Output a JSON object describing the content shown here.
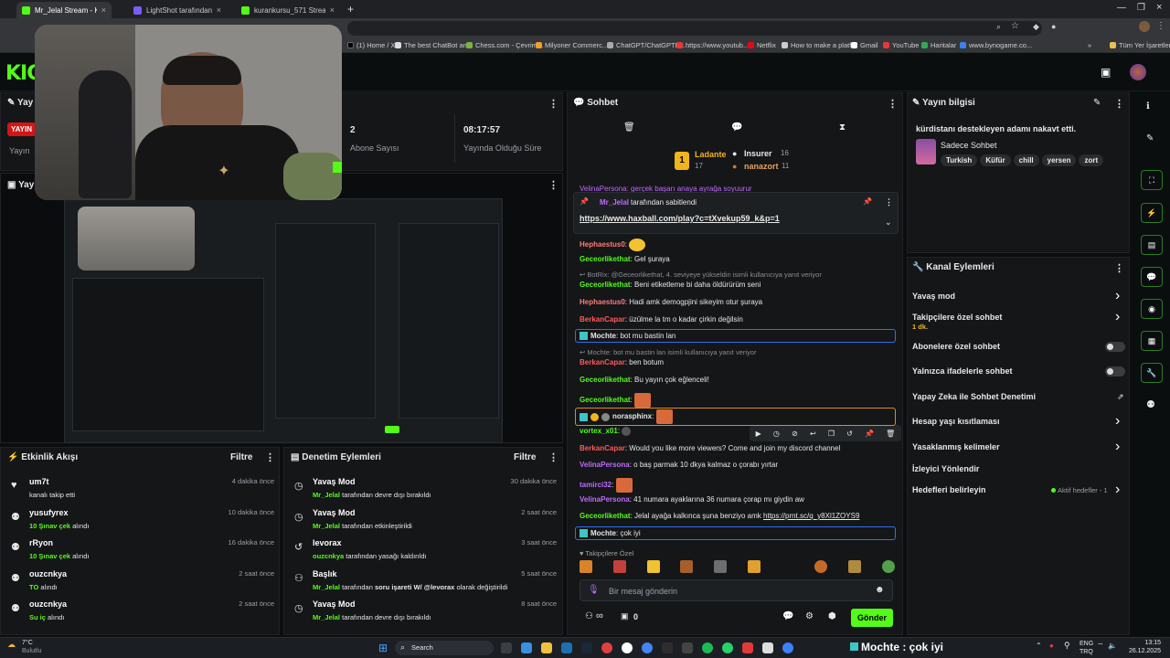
{
  "browser": {
    "tabs": [
      {
        "label": "Mr_Jelal Stream - Kick Dashbo..."
      },
      {
        "label": "LightShot tarafından Ekran Gö..."
      },
      {
        "label": "kurankursu_571 Stream - Watc..."
      }
    ],
    "new_tab": "+",
    "bookmarks": [
      "(1) Home / X",
      "The best ChatBot an...",
      "Chess.com - Çevrim...",
      "Milyoner Commerc...",
      "ChatGPT/ChatGPTHit...",
      "https://www.youtub...",
      "Netflix",
      "How to make a platf...",
      "Gmail",
      "YouTube",
      "Haritalar",
      "www.bynogame.co..."
    ],
    "all_bookmarks": "Tüm Yer İşaretleri"
  },
  "kick": {
    "logo": "KICK"
  },
  "stream_info_panel": {
    "title": "Yay",
    "live_badge": "YAYIN",
    "live_sub": "Yayın",
    "subs_count": "2",
    "subs_label": "Abone Sayısı",
    "uptime": "08:17:57",
    "uptime_label": "Yayında Olduğu Süre"
  },
  "preview_panel": {
    "title": "Yay"
  },
  "chat": {
    "title": "Sohbet",
    "leaderboard": [
      {
        "rank": "1",
        "name": "Ladante",
        "count": "17"
      },
      {
        "rank": "2",
        "name": "Insurer",
        "count": "16"
      },
      {
        "rank": "3",
        "name": "nanazort",
        "count": "11"
      }
    ],
    "cut_line": "VelinaPersona: gerçek başarı anaya ayrağa soyuurur",
    "pinned_by": "Mr_Jelal",
    "pinned_suffix": "tarafından sabitlendi",
    "pinned_link": "https://www.haxball.com/play?c=tXvekup59_k&p=1",
    "messages": [
      {
        "user": "Hephaestus0",
        "text": ""
      },
      {
        "user": "Geceorlikethat",
        "text": "Gel şuraya"
      },
      {
        "reply": "BotRix: @Geceorlikethat, 4. seviyeye yükseldin isimli kullanıcıya yanıt veriyor"
      },
      {
        "user": "Geceorlikethat",
        "text": "Beni etiketleme bi daha öldürürüm seni"
      },
      {
        "user": "Hephaestus0",
        "text": "Hadi amk demogpjini sikeyim otur şuraya"
      },
      {
        "user": "BerkanCapar",
        "text": "üzülme la tm o kadar çirkin değilsin"
      },
      {
        "user": "Mochte",
        "text": "bot mu bastin lan"
      },
      {
        "reply": "Mochte: bot mu bastin lan isimli kullanıcıya yanıt veriyor"
      },
      {
        "user": "BerkanCapar",
        "text": "ben botum"
      },
      {
        "user": "Geceorlikethat",
        "text": "Bu yayın çok eğlenceli!"
      },
      {
        "user": "Geceorlikethat",
        "text": ""
      },
      {
        "user": "norasphinx",
        "text": ""
      },
      {
        "user": "vortex_x01",
        "text": ""
      },
      {
        "user": "BerkanCapar",
        "text": "Would you like more viewers? Come and join my discord channel"
      },
      {
        "user": "VelinaPersona",
        "text": "o baş parmak 10 dkya kalmaz o çorabı yırtar"
      },
      {
        "user": "tamirci32",
        "text": ""
      },
      {
        "user": "VelinaPersona",
        "text": "41 numara ayaklarına 36 numara çorap mı giydin aw"
      },
      {
        "user": "Geceorlikethat",
        "text": "Jelal ayağa kalkınca şuna benziyo amk",
        "link": "https://prnt.sc/q_y8Xl1ZOYS9"
      },
      {
        "user": "Mochte",
        "text": "çok iyi"
      }
    ],
    "emote_label": "Takipçilere Özel",
    "input_placeholder": "Bir mesaj gönderin",
    "send_label": "Gönder",
    "infinity": "∞",
    "zero": "0"
  },
  "info": {
    "title": "Yayın bilgisi",
    "stream_title": "kürdistanı destekleyen adamı nakavt etti.",
    "category": "Sadece Sohbet",
    "tags": [
      "Turkish",
      "Küfür",
      "chill",
      "yersen",
      "zort"
    ]
  },
  "channel_actions": {
    "title": "Kanal Eylemleri",
    "items": [
      {
        "label": "Yavaş mod",
        "type": "chevron"
      },
      {
        "label": "Takipçilere özel sohbet",
        "sub": "1 dk.",
        "type": "chevron"
      },
      {
        "label": "Abonelere özel sohbet",
        "type": "toggle"
      },
      {
        "label": "Yalnızca ifadelerle sohbet",
        "type": "toggle"
      },
      {
        "label": "Yapay Zeka ile Sohbet Denetimi",
        "type": "ext"
      },
      {
        "label": "Hesap yaşı kısıtlaması",
        "type": "chevron"
      },
      {
        "label": "Yasaklanmış kelimeler",
        "type": "chevron"
      },
      {
        "label": "İzleyici Yönlendir",
        "type": "none"
      },
      {
        "label": "Hedefleri belirleyin",
        "type": "goal"
      }
    ],
    "active_goals": "Aktif hedefler - 1"
  },
  "activity": {
    "title": "Etkinlik Akışı",
    "filter": "Filtre",
    "items": [
      {
        "user": "um7t",
        "action": "kanalı takip etti",
        "time": "4 dakika önce"
      },
      {
        "user": "yusufyrex",
        "highlight": "10 Şınav çek",
        "action": "alındı",
        "time": "10 dakika önce"
      },
      {
        "user": "rRyon",
        "highlight": "10 Şınav çek",
        "action": "alındı",
        "time": "16 dakika önce"
      },
      {
        "user": "ouzcnkya",
        "highlight": "TO",
        "action": "alındı",
        "time": "2 saat önce"
      },
      {
        "user": "ouzcnkya",
        "highlight": "Su iç",
        "action": "alındı",
        "time": "2 saat önce"
      }
    ]
  },
  "moderation": {
    "title": "Denetim Eylemleri",
    "filter": "Filtre",
    "items": [
      {
        "title": "Yavaş Mod",
        "actor": "Mr_Jelal",
        "action": "tarafından devre dışı bırakıldı",
        "time": "30 dakika önce"
      },
      {
        "title": "Yavaş Mod",
        "actor": "Mr_Jelal",
        "action": "tarafından etkinleştirildi",
        "time": "2 saat önce"
      },
      {
        "title": "levorax",
        "actor": "ouzcnkya",
        "action": "tarafından yasağı kaldırıldı",
        "time": "3 saat önce"
      },
      {
        "title": "Başlık",
        "actor": "Mr_Jelal",
        "action": "tarafından",
        "bold": "soru işareti W/ @levorax",
        "rest": "olarak değiştirildi",
        "time": "5 saat önce"
      },
      {
        "title": "Yavaş Mod",
        "actor": "Mr_Jelal",
        "action": "tarafından devre dışı bırakıldı",
        "time": "8 saat önce"
      }
    ]
  },
  "taskbar": {
    "weather_temp": "7°C",
    "weather_label": "Bulutlu",
    "search": "Search",
    "lang_top": "ENG",
    "lang_bottom": "TRQ",
    "time": "13:15",
    "date": "26.12.2025"
  },
  "overlay": {
    "text": "Mochte : çok iyi"
  }
}
